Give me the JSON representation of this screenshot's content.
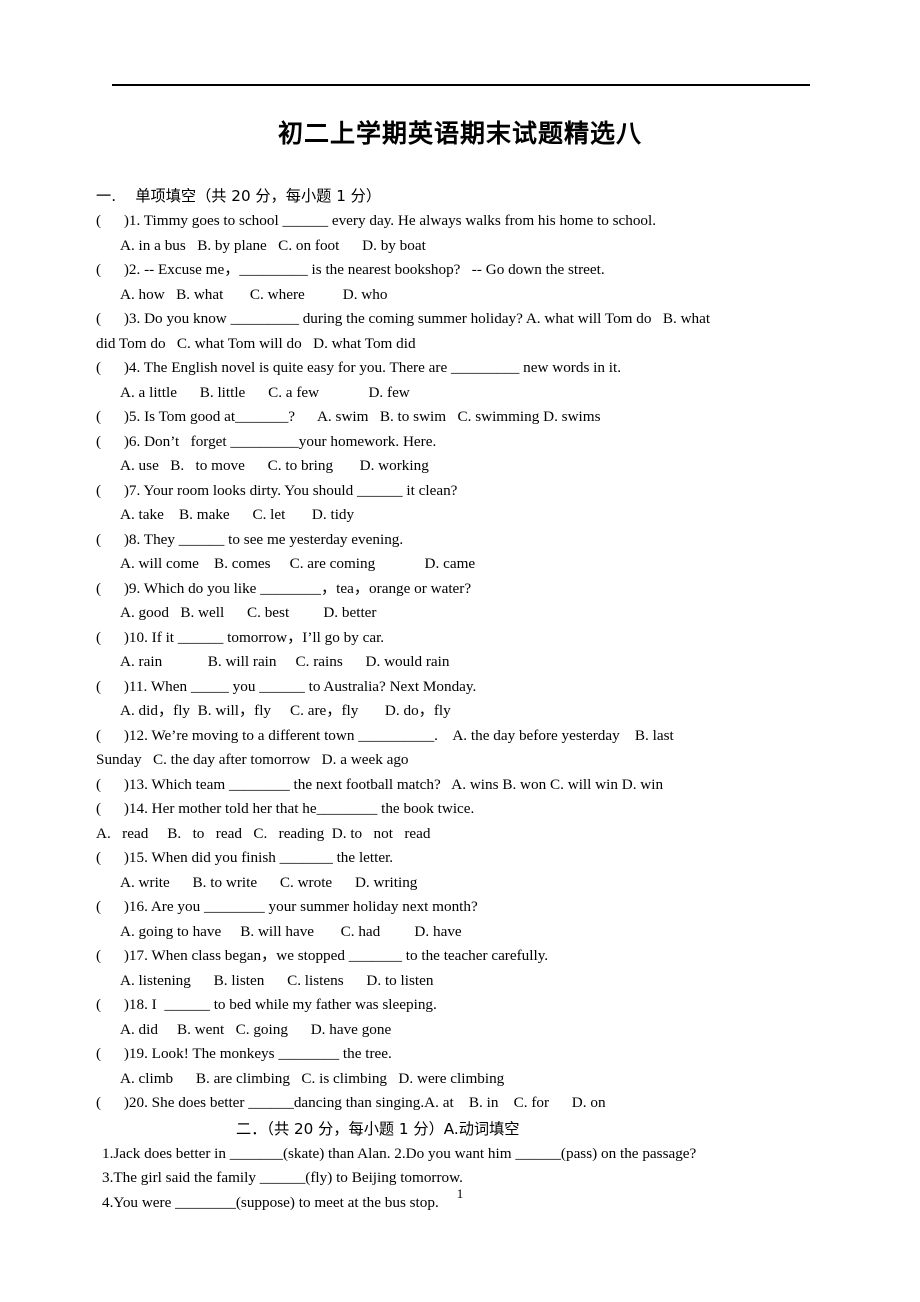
{
  "document": {
    "title": "初二上学期英语期末试题精选八",
    "page_number": "1"
  },
  "section1": {
    "heading": "一.    单项填空（共 20 分，每小题 1 分）",
    "questions": [
      {
        "stem": "(      )1. Timmy goes to school ______ every day. He always walks from his home to school.",
        "options": "A. in a bus   B. by plane   C. on foot      D. by boat"
      },
      {
        "stem": "(      )2. -- Excuse me，_________ is the nearest bookshop?   -- Go down the street.",
        "options": "A. how   B. what       C. where          D. who"
      },
      {
        "stem": "(      )3. Do you know _________ during the coming summer holiday? A. what will Tom do   B. what",
        "continuation": "did Tom do   C. what Tom will do   D. what Tom did"
      },
      {
        "stem": "(      )4. The English novel is quite easy for you. There are _________ new words in it.",
        "options": "A. a little      B. little      C. a few             D. few"
      },
      {
        "stem": "(      )5. Is Tom good at_______?      A. swim   B. to swim   C. swimming D. swims"
      },
      {
        "stem": "(      )6. Don’t   forget _________your homework. Here.",
        "options": "A. use   B.   to move      C. to bring       D. working"
      },
      {
        "stem": "(      )7. Your room looks dirty. You should ______ it clean?",
        "options": "A. take    B. make      C. let       D. tidy"
      },
      {
        "stem": "(      )8. They ______ to see me yesterday evening.",
        "options": "A. will come    B. comes     C. are coming             D. came"
      },
      {
        "stem": "(      )9. Which do you like ________，tea，orange or water?",
        "options": "A. good   B. well      C. best         D. better"
      },
      {
        "stem": "(      )10. If it ______ tomorrow，I’ll go by car.",
        "options": "A. rain            B. will rain     C. rains      D. would rain"
      },
      {
        "stem": "(      )11. When _____ you ______ to Australia? Next Monday.",
        "options": "A. did，fly  B. will，fly     C. are，fly       D. do，fly"
      },
      {
        "stem": "(      )12. We’re moving to a different town __________.    A. the day before yesterday    B. last",
        "continuation": "Sunday   C. the day after tomorrow   D. a week ago"
      },
      {
        "stem": "(      )13. Which team ________ the next football match?   A. wins B. won C. will win D. win"
      },
      {
        "stem": "(      )14. Her mother told her that he________ the book twice.",
        "continuation": "A.   read     B.   to   read   C.   reading  D. to   not   read"
      },
      {
        "stem": "(      )15. When did you finish _______ the letter.",
        "options": "A. write      B. to write      C. wrote      D. writing"
      },
      {
        "stem": "(      )16. Are you ________ your summer holiday next month?",
        "options": "A. going to have     B. will have       C. had         D. have"
      },
      {
        "stem": "(      )17. When class began，we stopped _______ to the teacher carefully.",
        "options": "A. listening      B. listen      C. listens      D. to listen"
      },
      {
        "stem": "(      )18. I  ______ to bed while my father was sleeping.",
        "options": "A. did     B. went   C. going      D. have gone"
      },
      {
        "stem": "(      )19. Look! The monkeys ________ the tree.",
        "options": "A. climb      B. are climbing   C. is climbing   D. were climbing"
      },
      {
        "stem": "(      )20. She does better ______dancing than singing.A. at    B. in    C. for      D. on"
      }
    ]
  },
  "section2": {
    "heading": "二．（共 20 分，每小题 1 分）A.动词填空",
    "items": [
      "1.Jack does better in _______(skate) than Alan. 2.Do you want him ______(pass) on the passage?",
      "3.The girl said the family ______(fly) to Beijing tomorrow.",
      "4.You were ________(suppose) to meet at the bus stop."
    ]
  }
}
